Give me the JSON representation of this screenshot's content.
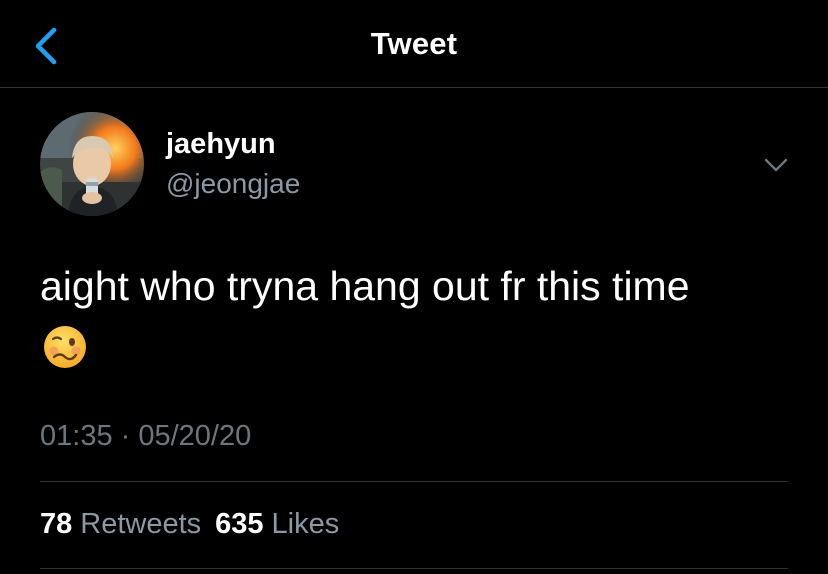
{
  "header": {
    "title": "Tweet",
    "back_icon": "chevron-left-icon"
  },
  "colors": {
    "accent": "#1da1f2",
    "background": "#000000",
    "secondary_text": "#8b98a5",
    "divider": "#2f3336"
  },
  "tweet": {
    "author": {
      "display_name": "jaehyun",
      "handle": "@jeongjae"
    },
    "text": "aight who tryna hang out fr this time",
    "emoji": "woozy-face-emoji",
    "timestamp": "01:35 · 05/20/20",
    "stats": {
      "retweets": {
        "count": "78",
        "label": "Retweets"
      },
      "likes": {
        "count": "635",
        "label": "Likes"
      }
    }
  }
}
